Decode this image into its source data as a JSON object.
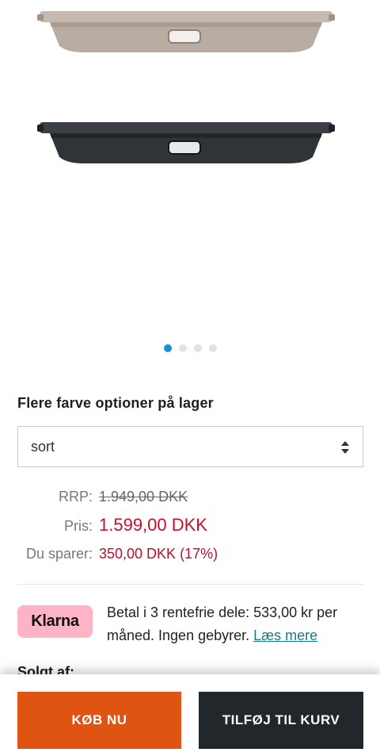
{
  "gallery": {
    "images": [
      {
        "icon": "cargo-cover-beige-image",
        "color": "#b9aca2"
      },
      {
        "icon": "cargo-cover-black-image",
        "color": "#2f3438"
      }
    ],
    "dots_count": 4,
    "active_dot": 0
  },
  "options": {
    "title": "Flere farve optioner på lager",
    "selected": "sort"
  },
  "pricing": {
    "rrp_label": "RRP:",
    "rrp_value": "1.949,00 DKK",
    "price_label": "Pris:",
    "price_value": "1.599,00 DKK",
    "save_label": "Du sparer:",
    "save_value": "350,00 DKK (17%)"
  },
  "klarna": {
    "logo": "Klarna",
    "text": "Betal i 3 rentefrie dele: 533,00 kr per måned. Ingen gebyrer.",
    "link": "Læs mere"
  },
  "seller": {
    "label": "Solgt af:"
  },
  "actions": {
    "buy_now": "KØB NU",
    "add_to_cart": "TILFØJ TIL KURV"
  },
  "colors": {
    "accent_blue": "#1a8fd6",
    "price_red": "#c8102e",
    "buy_orange": "#e05412",
    "cart_dark": "#22272c",
    "klarna_pink": "#ffb3c7"
  }
}
